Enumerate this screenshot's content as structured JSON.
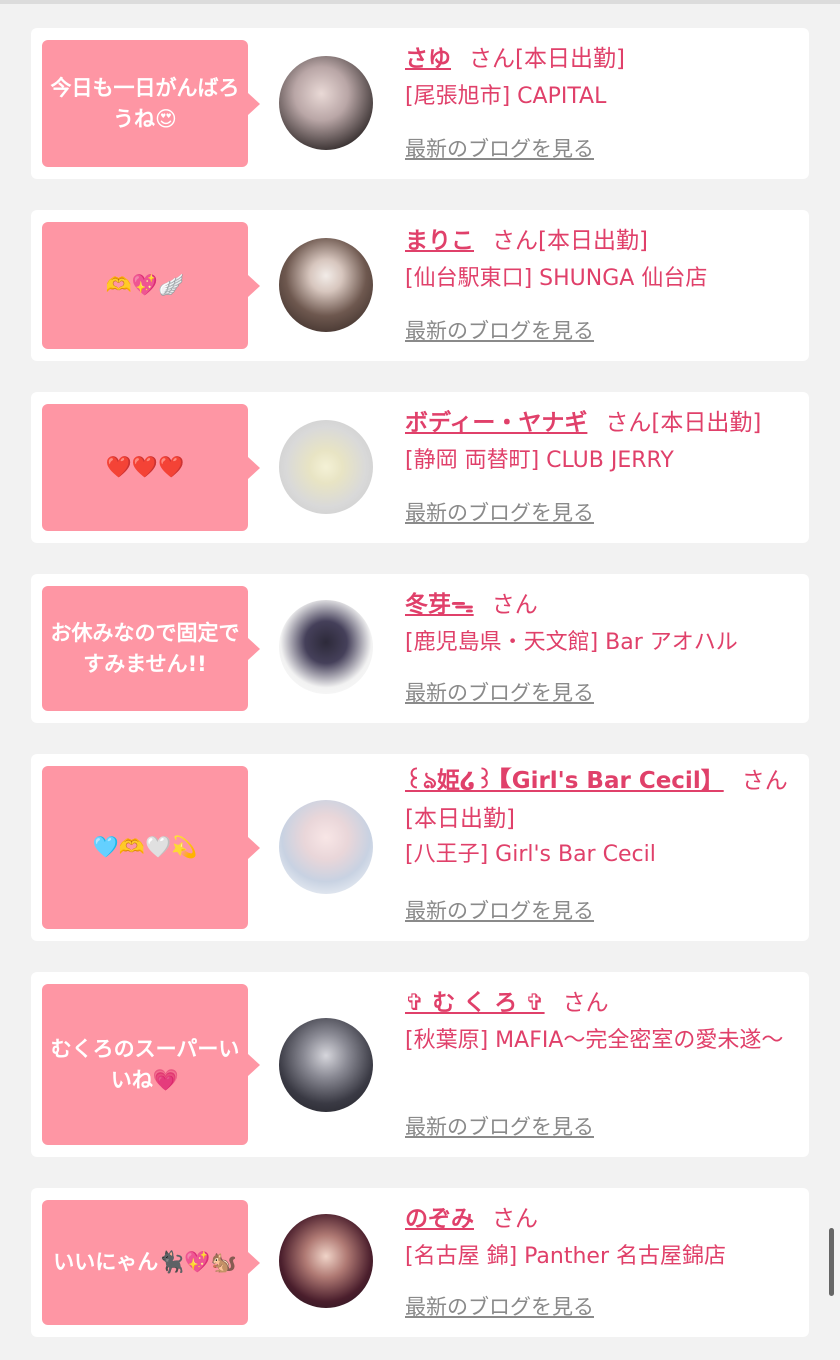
{
  "accent_color": "#e0406a",
  "bubble_color": "#fe96a4",
  "cards": [
    {
      "message": "今日も一日がんばろうね😍",
      "name": "さゆ",
      "suffix": "さん[本日出勤]",
      "extra": "",
      "shop": "[尾張旭市] CAPITAL",
      "blog_link": "最新のブログを見る"
    },
    {
      "message": "🫶💖🪽",
      "name": "まりこ",
      "suffix": "さん[本日出勤]",
      "extra": "",
      "shop": "[仙台駅東口] SHUNGA 仙台店",
      "blog_link": "最新のブログを見る"
    },
    {
      "message": "❤️❤️❤️",
      "name": "ボディー・ヤナギ",
      "suffix": "さん[本日出勤]",
      "extra": "",
      "shop": "[静岡 両替町] CLUB JERRY",
      "blog_link": "最新のブログを見る"
    },
    {
      "message": "お休みなので固定ですみません!!",
      "name": "冬芽ᯓ",
      "suffix": "さん",
      "extra": "",
      "shop": "[鹿児島県・天文館] Bar アオハル",
      "blog_link": "最新のブログを見る"
    },
    {
      "message": "🩵🫶🤍💫",
      "name": "꒰ঌ姫໒꒱【Girl's Bar Cecil】",
      "suffix": "さん",
      "extra": "[本日出勤]",
      "shop": "[八王子] Girl's Bar Cecil",
      "blog_link": "最新のブログを見る"
    },
    {
      "message": "むくろのスーパーいいね💗",
      "name": "✞ む く ろ ✞",
      "suffix": "さん",
      "extra": "",
      "shop": "[秋葉原] MAFIA〜完全密室の愛未遂〜",
      "blog_link": "最新のブログを見る"
    },
    {
      "message": "いいにゃん🐈‍⬛💖🐿️",
      "name": "のぞみ",
      "suffix": "さん",
      "extra": "",
      "shop": "[名古屋 錦] Panther 名古屋錦店",
      "blog_link": "最新のブログを見る"
    }
  ]
}
